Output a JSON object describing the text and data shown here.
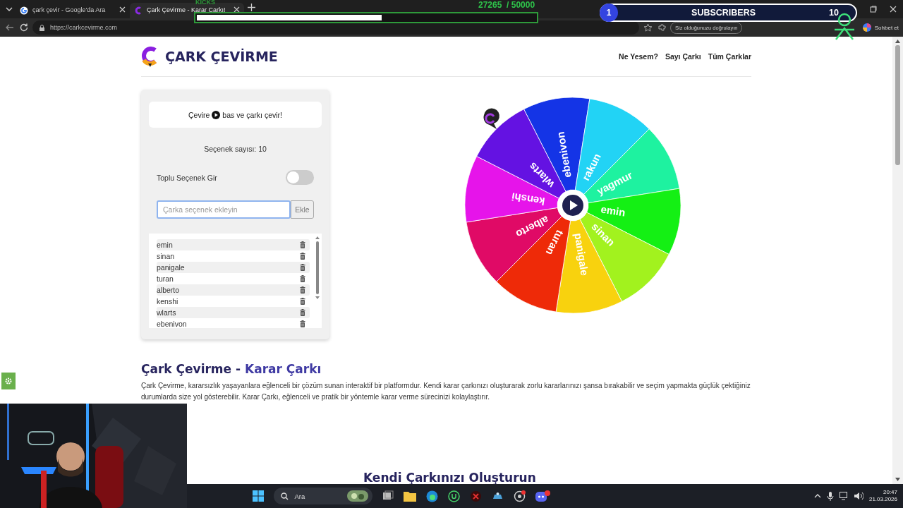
{
  "browser": {
    "tabs": [
      {
        "title": "çark çevir - Google'da Ara",
        "selected": false
      },
      {
        "title": "Çark Çevirme - Karar Çarkı!",
        "selected": true
      }
    ],
    "url": "https://carkcevirme.com",
    "verify_label": "Siz olduğunuzu doğrulayın",
    "chat_label": "Sohbet et"
  },
  "stream_overlay": {
    "kicks_label": "KICKS",
    "kicks_count": "27265  / 50000",
    "level": 0.545,
    "subscriber_badge": "1",
    "subscribers_label": "SUBSCRIBERS",
    "subscribers_goal": "10"
  },
  "site": {
    "logo": "ÇARK ÇEVİRME",
    "nav": [
      "Ne Yesem?",
      "Sayı Çarkı",
      "Tüm Çarklar"
    ]
  },
  "panel": {
    "hint_before": "Çevire",
    "hint_after": "bas ve çarkı çevir!",
    "count": "Seçenek sayısı: 10",
    "bulk_label": "Toplu Seçenek Gir",
    "bulk_on": false,
    "input_placeholder": "Çarka seçenek ekleyin",
    "add_button": "Ekle",
    "options": [
      "emin",
      "sinan",
      "panigale",
      "turan",
      "alberto",
      "kenshi",
      "wlarts",
      "ebenivon"
    ]
  },
  "wheel": {
    "segments": [
      {
        "label": "ebenivon",
        "color": "#1434e6"
      },
      {
        "label": "rakun",
        "color": "#22d3f5"
      },
      {
        "label": "yagmur",
        "color": "#1ef2a0"
      },
      {
        "label": "emin",
        "color": "#14f014"
      },
      {
        "label": "sinan",
        "color": "#a2f21e"
      },
      {
        "label": "panigale",
        "color": "#f8d20e"
      },
      {
        "label": "turan",
        "color": "#ee2a08"
      },
      {
        "label": "alberto",
        "color": "#e00a66"
      },
      {
        "label": "kenshi",
        "color": "#e614ea"
      },
      {
        "label": "wlarts",
        "color": "#6412e2"
      }
    ]
  },
  "article": {
    "title": "Çark Çevirme -",
    "title_accent": "Karar Çarkı",
    "text": "Çark Çevirme, kararsızlık yaşayanlara eğlenceli bir çözüm sunan interaktif bir platformdur. Kendi karar çarkınızı oluşturarak zorlu kararlarınızı şansa bırakabilir ve seçim yapmakta güçlük çektiğiniz durumlarda size yol gösterebilir. Karar Çarkı, eğlenceli ve pratik bir yöntemle karar verme sürecinizi kolaylaştırır.",
    "next_heading": "Kendi Çarkınızı Oluşturun"
  },
  "taskbar": {
    "search": "Ara",
    "time": "20:47",
    "date": "21.03.2026"
  }
}
